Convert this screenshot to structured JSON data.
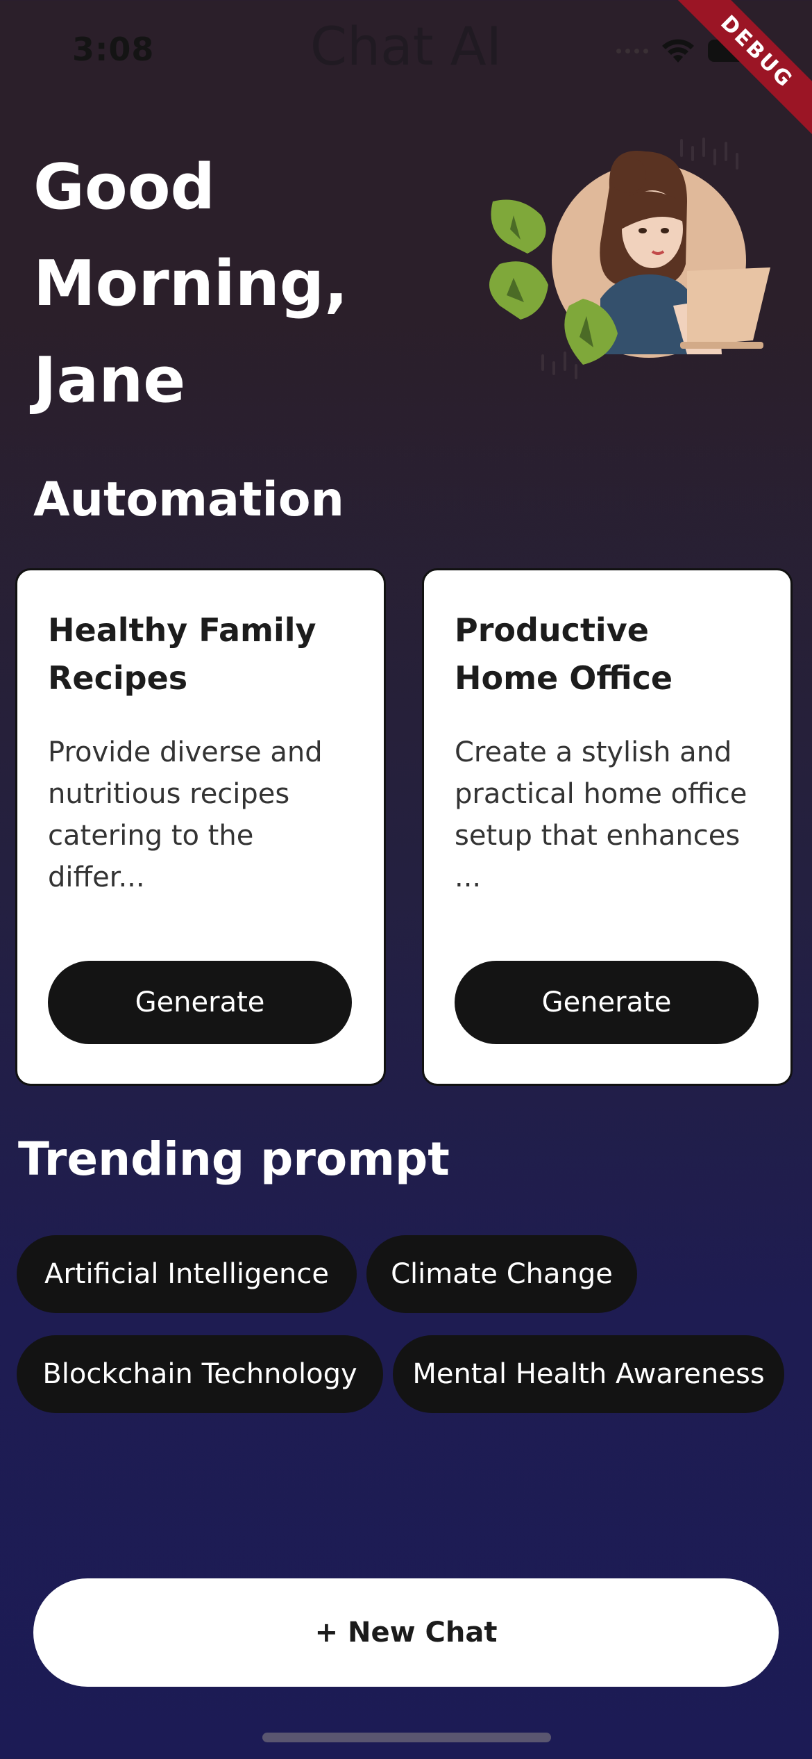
{
  "status_bar": {
    "time": "3:08"
  },
  "app_title": "Chat AI",
  "debug_banner": "DEBUG",
  "greeting": {
    "line1": "Good",
    "line2": "Morning,",
    "line3": "Jane"
  },
  "illustration": {
    "icon": "woman-working-on-laptop-illustration"
  },
  "automation": {
    "heading": "Automation",
    "cards": [
      {
        "title": "Healthy Family Recipes",
        "description": "Provide diverse and nutritious recipes catering to the differ...",
        "button": "Generate"
      },
      {
        "title": "Productive Home Office",
        "description": "Create a stylish and practical home office setup that enhances ...",
        "button": "Generate"
      }
    ]
  },
  "trending": {
    "heading": "Trending prompt",
    "chips": [
      "Artificial Intelligence",
      "Climate Change",
      "Blockchain Technology",
      "Mental Health Awareness"
    ]
  },
  "new_chat_button": "+ New Chat",
  "colors": {
    "background_top": "#2b1f2a",
    "background_bottom": "#1c1b55",
    "button_dark": "#141414",
    "card_bg": "#ffffff",
    "debug_ribbon": "#9b1525"
  }
}
